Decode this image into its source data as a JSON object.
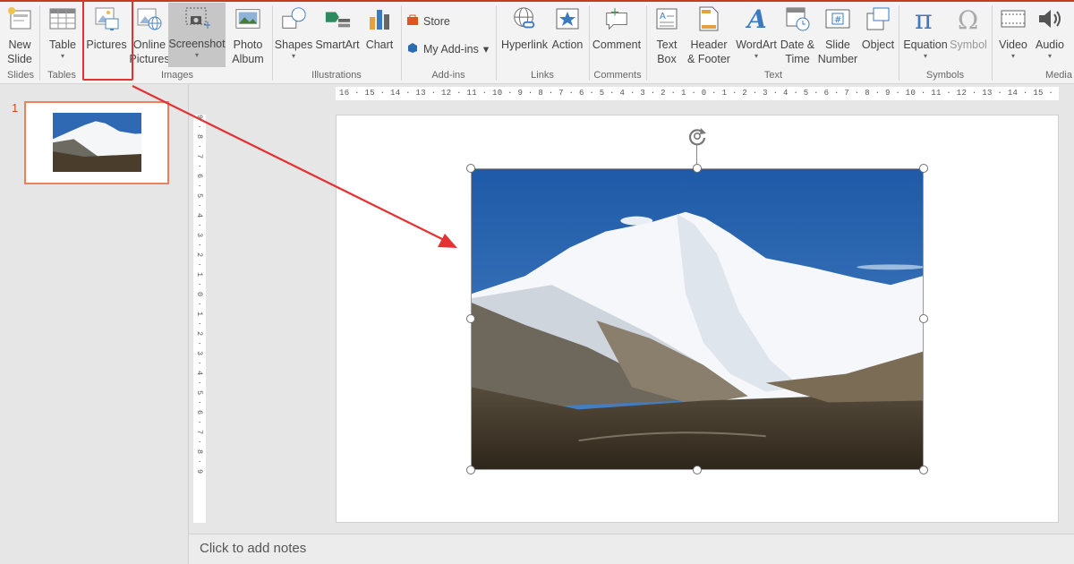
{
  "ribbon": {
    "buttons": {
      "new_slide": "New\nSlide",
      "table": "Table",
      "pictures": "Pictures",
      "online_pictures": "Online\nPictures",
      "screenshot": "Screenshot",
      "photo_album": "Photo\nAlbum",
      "shapes": "Shapes",
      "smartart": "SmartArt",
      "chart": "Chart",
      "store": "Store",
      "my_addins": "My Add-ins",
      "hyperlink": "Hyperlink",
      "action": "Action",
      "comment": "Comment",
      "text_box": "Text\nBox",
      "header_footer": "Header\n& Footer",
      "wordart": "WordArt",
      "date_time": "Date &\nTime",
      "slide_number": "Slide\nNumber",
      "object": "Object",
      "equation": "Equation",
      "symbol": "Symbol",
      "video": "Video",
      "audio": "Audio"
    },
    "groups": {
      "slides": "Slides",
      "tables": "Tables",
      "images": "Images",
      "illustrations": "Illustrations",
      "addins": "Add-ins",
      "links": "Links",
      "comments": "Comments",
      "text": "Text",
      "symbols": "Symbols",
      "media": "Media"
    },
    "highlighted_button": "Pictures",
    "active_button": "Screenshot"
  },
  "thumbnails": {
    "slide_number": "1"
  },
  "rulers": {
    "horizontal": "16 · 15 · 14 · 13 · 12 · 11 · 10 · 9 · 8 · 7 · 6 · 5 · 4 · 3 · 2 · 1 · 0 · 1 · 2 · 3 · 4 · 5 · 6 · 7 · 8 · 9 · 10 · 11 · 12 · 13 · 14 · 15 · 16",
    "vertical": "9 · 8 · 7 · 6 · 5 · 4 · 3 · 2 · 1 · 0 · 1 · 2 · 3 · 4 · 5 · 6 · 7 · 8 · 9"
  },
  "notes": {
    "placeholder": "Click to add notes"
  },
  "colors": {
    "accent": "#c43e1c",
    "highlight": "#e53131",
    "thumb_border": "#e9815b"
  },
  "icons": [
    "new-slide-icon",
    "table-icon",
    "pictures-icon",
    "online-pictures-icon",
    "screenshot-icon",
    "photo-album-icon",
    "shapes-icon",
    "smartart-icon",
    "chart-icon",
    "store-icon",
    "my-addins-icon",
    "hyperlink-icon",
    "action-icon",
    "comment-icon",
    "text-box-icon",
    "header-footer-icon",
    "wordart-icon",
    "date-time-icon",
    "slide-number-icon",
    "object-icon",
    "equation-icon",
    "symbol-icon",
    "video-icon",
    "audio-icon",
    "rotate-handle-icon"
  ]
}
